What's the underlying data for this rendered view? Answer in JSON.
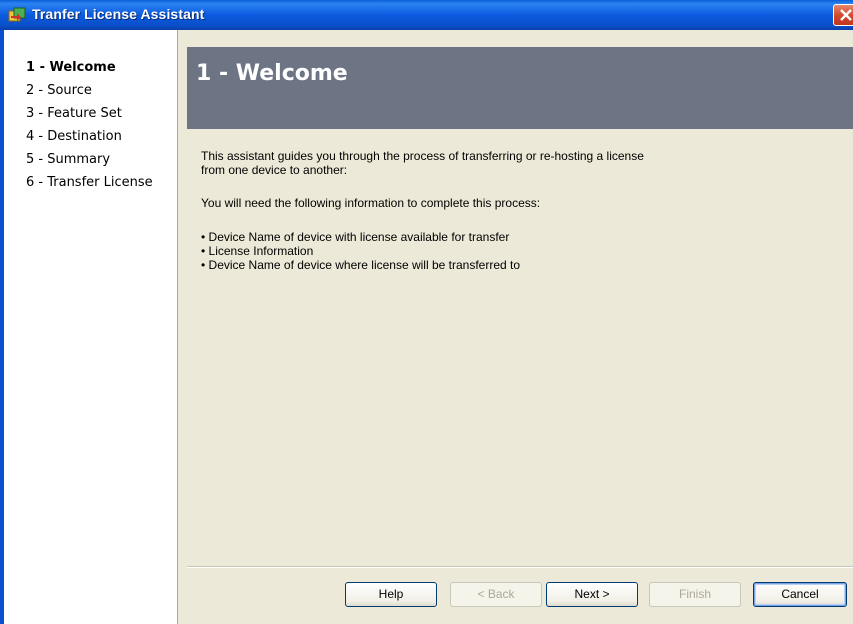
{
  "window": {
    "title": "Tranfer License Assistant",
    "icon": "license-assistant-icon",
    "close_icon": "close-icon"
  },
  "nav": {
    "items": [
      {
        "label": "1 - Welcome",
        "active": true
      },
      {
        "label": "2 - Source"
      },
      {
        "label": "3 - Feature Set"
      },
      {
        "label": "4 - Destination"
      },
      {
        "label": "5 - Summary"
      },
      {
        "label": "6 - Transfer License"
      }
    ]
  },
  "page": {
    "heading": "1 - Welcome",
    "intro_line1": "This assistant guides you through the process of transferring or re-hosting a license",
    "intro_line2": "from one device to another:",
    "info_needed": "You will need the following information to complete this process:",
    "bullets": [
      "• Device Name of device with license available for transfer",
      "• License Information",
      "• Device Name of device where license will be transferred to"
    ]
  },
  "buttons": {
    "help": "Help",
    "back": "< Back",
    "next": "Next >",
    "finish": "Finish",
    "cancel": "Cancel"
  },
  "colors": {
    "header_bg": "#6d7585",
    "titlebar": "#0d5ae0",
    "window_bg": "#ece9d8"
  }
}
